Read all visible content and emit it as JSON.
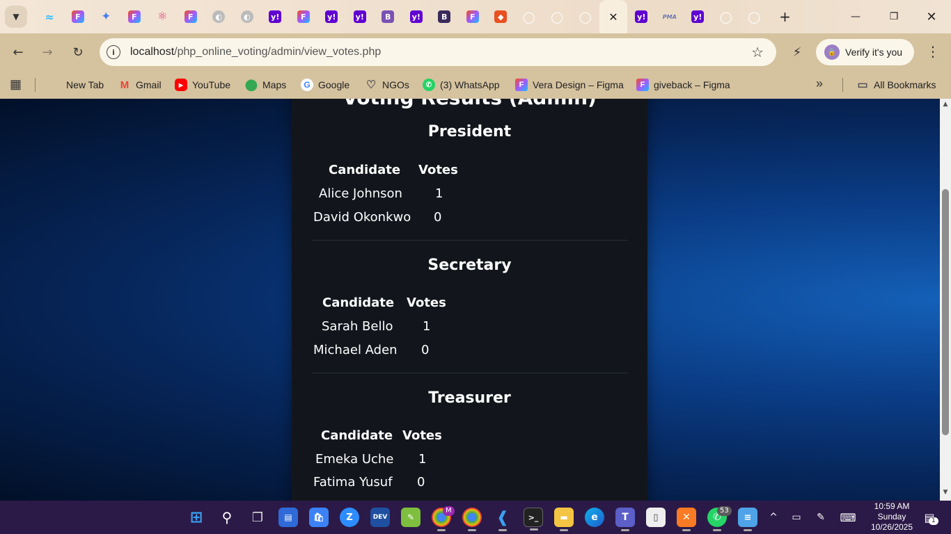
{
  "browser": {
    "tab_count_icons": [
      "tailwind-icon",
      "figma-icon",
      "gemini-icon",
      "figma-icon",
      "react-icon",
      "figma-icon",
      "globe-icon",
      "globe-icon",
      "yahoo-icon",
      "figma-icon",
      "yahoo-icon",
      "yahoo-icon",
      "bootstrap-icon",
      "yahoo-icon",
      "bootstrap-dark-icon",
      "figma-icon",
      "brave-icon",
      "github-icon",
      "github-icon",
      "github-icon",
      "close-icon",
      "yahoo-icon",
      "phpmyadmin-icon",
      "yahoo-icon",
      "github-icon",
      "github-icon"
    ],
    "phpmyadmin_tab_label": "PMA",
    "address": {
      "host": "localhost",
      "path": "/php_online_voting/admin/view_votes.php"
    },
    "verify_label": "Verify it's you",
    "bookmarks": [
      {
        "label": "New Tab",
        "icon": "none"
      },
      {
        "label": "Gmail",
        "icon": "gmail-icon"
      },
      {
        "label": "YouTube",
        "icon": "youtube-icon"
      },
      {
        "label": "Maps",
        "icon": "maps-icon"
      },
      {
        "label": "Google",
        "icon": "google-icon"
      },
      {
        "label": "NGOs",
        "icon": "ngo-icon"
      },
      {
        "label": "(3) WhatsApp",
        "icon": "whatsapp-icon"
      },
      {
        "label": "Vera Design – Figma",
        "icon": "figma-icon"
      },
      {
        "label": "giveback – Figma",
        "icon": "figma-icon"
      }
    ],
    "all_bookmarks_label": "All Bookmarks",
    "colors": {
      "tab_strip": "#f0e0cf",
      "toolbar": "#d5c29f"
    }
  },
  "page": {
    "title": "Voting Results (Admin)",
    "header_candidate": "Candidate",
    "header_votes": "Votes",
    "positions": [
      {
        "name": "President",
        "candidates": [
          {
            "name": "Alice Johnson",
            "votes": "1"
          },
          {
            "name": "David Okonkwo",
            "votes": "0"
          }
        ]
      },
      {
        "name": "Secretary",
        "candidates": [
          {
            "name": "Sarah Bello",
            "votes": "1"
          },
          {
            "name": "Michael Aden",
            "votes": "0"
          }
        ]
      },
      {
        "name": "Treasurer",
        "candidates": [
          {
            "name": "Emeka Uche",
            "votes": "1"
          },
          {
            "name": "Fatima Yusuf",
            "votes": "0"
          }
        ]
      }
    ],
    "colors": {
      "card_bg": "#12161c",
      "page_bg": "#0a3c85"
    }
  },
  "taskbar": {
    "whatsapp_badge": "53",
    "chrome_badge": "M",
    "clock_time": "10:59 AM",
    "clock_day": "Sunday",
    "clock_date": "10/26/2025",
    "notification_badge": "1"
  }
}
